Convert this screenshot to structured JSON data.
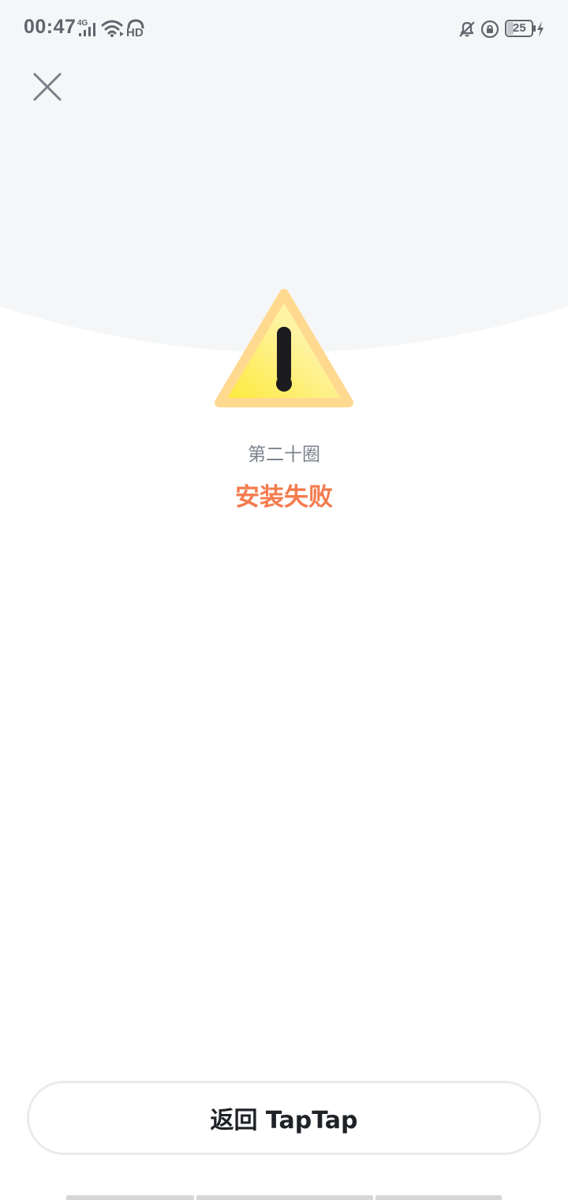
{
  "status_bar": {
    "time": "00:47",
    "network": "4G",
    "hd_label": "HD",
    "battery": "25"
  },
  "app": {
    "name": "第二十圈",
    "status": "安装失败"
  },
  "actions": {
    "return_label": "返回 TapTap"
  },
  "icons": {
    "close": "close-icon",
    "warning": "warning-icon"
  },
  "colors": {
    "top_background": "#f5f6f7",
    "status_text": "#f57b4e",
    "app_name_text": "#7c838c",
    "warning_fill": "#fde96b",
    "warning_border": "#ffd88a"
  }
}
